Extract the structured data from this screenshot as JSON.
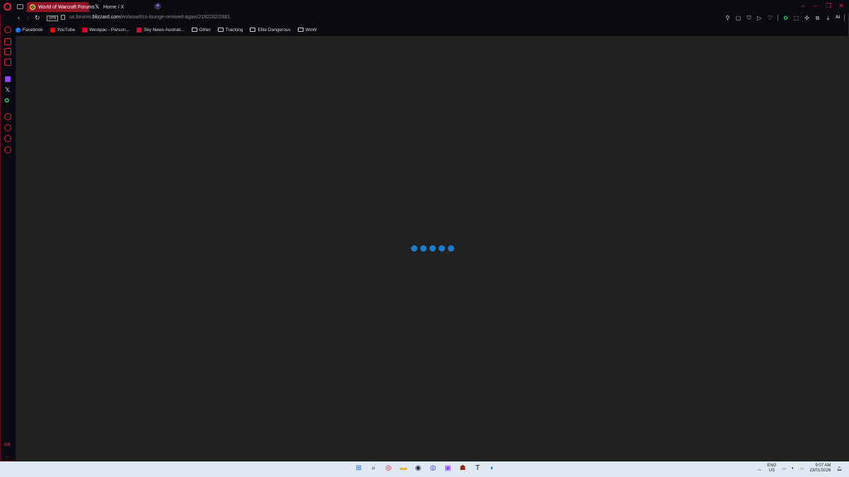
{
  "tabs": [
    {
      "title": "World of Warcraft Forums",
      "active": true
    },
    {
      "title": "Home / X",
      "active": false
    }
  ],
  "address": {
    "url_prefix": "us.forums.",
    "url_domain": "blizzard.com",
    "url_path": "/en/wow/t/cs-lounge-remixed-again/2192282/2881",
    "vpn_label": "VPN"
  },
  "bookmarks": [
    {
      "label": "Facebook",
      "icon": "facebook-icon",
      "color": "#1877f2"
    },
    {
      "label": "YouTube",
      "icon": "youtube-icon",
      "color": "#ff0000"
    },
    {
      "label": "Westpac - Person...",
      "icon": "westpac-icon",
      "color": "#d5002b"
    },
    {
      "label": "Sky News Australi...",
      "icon": "skynews-icon",
      "color": "#c8102e"
    },
    {
      "label": "Other",
      "icon": "folder-icon"
    },
    {
      "label": "Tracking",
      "icon": "folder-icon"
    },
    {
      "label": "Elite Dangerous",
      "icon": "folder-icon"
    },
    {
      "label": "WoW",
      "icon": "folder-icon"
    }
  ],
  "toolbar": {
    "ai_label": "AI"
  },
  "sidebar": {
    "gx_label": "GX",
    "more_label": "···"
  },
  "taskbar": {
    "lang_line1": "ENG",
    "lang_line2": "US",
    "time": "9:07 AM",
    "date": "23/01/2026"
  },
  "colors": {
    "accent": "#e0203a",
    "loader": "#1a7ccc",
    "content_bg": "#212121"
  }
}
